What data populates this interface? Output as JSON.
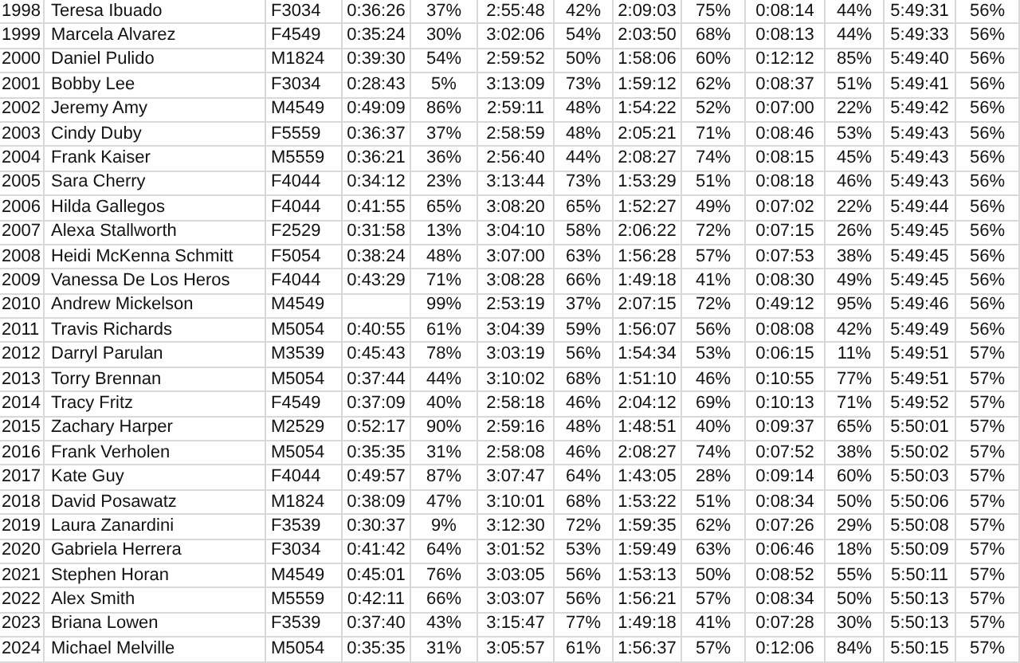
{
  "table": {
    "rows": [
      {
        "cells": [
          "1998",
          "Teresa Ibuado",
          "F3034",
          "0:36:26",
          "37%",
          "2:55:48",
          "42%",
          "2:09:03",
          "75%",
          "0:08:14",
          "44%",
          "5:49:31",
          "56%"
        ]
      },
      {
        "cells": [
          "1999",
          "Marcela Alvarez",
          "F4549",
          "0:35:24",
          "30%",
          "3:02:06",
          "54%",
          "2:03:50",
          "68%",
          "0:08:13",
          "44%",
          "5:49:33",
          "56%"
        ]
      },
      {
        "cells": [
          "2000",
          "Daniel Pulido",
          "M1824",
          "0:39:30",
          "54%",
          "2:59:52",
          "50%",
          "1:58:06",
          "60%",
          "0:12:12",
          "85%",
          "5:49:40",
          "56%"
        ]
      },
      {
        "cells": [
          "2001",
          "Bobby Lee",
          "F3034",
          "0:28:43",
          "5%",
          "3:13:09",
          "73%",
          "1:59:12",
          "62%",
          "0:08:37",
          "51%",
          "5:49:41",
          "56%"
        ]
      },
      {
        "cells": [
          "2002",
          "Jeremy Amy",
          "M4549",
          "0:49:09",
          "86%",
          "2:59:11",
          "48%",
          "1:54:22",
          "52%",
          "0:07:00",
          "22%",
          "5:49:42",
          "56%"
        ]
      },
      {
        "cells": [
          "2003",
          "Cindy Duby",
          "F5559",
          "0:36:37",
          "37%",
          "2:58:59",
          "48%",
          "2:05:21",
          "71%",
          "0:08:46",
          "53%",
          "5:49:43",
          "56%"
        ]
      },
      {
        "cells": [
          "2004",
          "Frank Kaiser",
          "M5559",
          "0:36:21",
          "36%",
          "2:56:40",
          "44%",
          "2:08:27",
          "74%",
          "0:08:15",
          "45%",
          "5:49:43",
          "56%"
        ]
      },
      {
        "cells": [
          "2005",
          "Sara Cherry",
          "F4044",
          "0:34:12",
          "23%",
          "3:13:44",
          "73%",
          "1:53:29",
          "51%",
          "0:08:18",
          "46%",
          "5:49:43",
          "56%"
        ]
      },
      {
        "cells": [
          "2006",
          "Hilda Gallegos",
          "F4044",
          "0:41:55",
          "65%",
          "3:08:20",
          "65%",
          "1:52:27",
          "49%",
          "0:07:02",
          "22%",
          "5:49:44",
          "56%"
        ]
      },
      {
        "cells": [
          "2007",
          "Alexa Stallworth",
          "F2529",
          "0:31:58",
          "13%",
          "3:04:10",
          "58%",
          "2:06:22",
          "72%",
          "0:07:15",
          "26%",
          "5:49:45",
          "56%"
        ]
      },
      {
        "cells": [
          "2008",
          "Heidi McKenna Schmitt",
          "F5054",
          "0:38:24",
          "48%",
          "3:07:00",
          "63%",
          "1:56:28",
          "57%",
          "0:07:53",
          "38%",
          "5:49:45",
          "56%"
        ]
      },
      {
        "cells": [
          "2009",
          "Vanessa De Los Heros",
          "F4044",
          "0:43:29",
          "71%",
          "3:08:28",
          "66%",
          "1:49:18",
          "41%",
          "0:08:30",
          "49%",
          "5:49:45",
          "56%"
        ]
      },
      {
        "cells": [
          "2010",
          "Andrew Mickelson",
          "M4549",
          null,
          "99%",
          "2:53:19",
          "37%",
          "2:07:15",
          "72%",
          "0:49:12",
          "95%",
          "5:49:46",
          "56%"
        ]
      },
      {
        "cells": [
          "2011",
          "Travis Richards",
          "M5054",
          "0:40:55",
          "61%",
          "3:04:39",
          "59%",
          "1:56:07",
          "56%",
          "0:08:08",
          "42%",
          "5:49:49",
          "56%"
        ]
      },
      {
        "cells": [
          "2012",
          "Darryl Parulan",
          "M3539",
          "0:45:43",
          "78%",
          "3:03:19",
          "56%",
          "1:54:34",
          "53%",
          "0:06:15",
          "11%",
          "5:49:51",
          "57%"
        ]
      },
      {
        "cells": [
          "2013",
          "Torry Brennan",
          "M5054",
          "0:37:44",
          "44%",
          "3:10:02",
          "68%",
          "1:51:10",
          "46%",
          "0:10:55",
          "77%",
          "5:49:51",
          "57%"
        ]
      },
      {
        "cells": [
          "2014",
          "Tracy Fritz",
          "F4549",
          "0:37:09",
          "40%",
          "2:58:18",
          "46%",
          "2:04:12",
          "69%",
          "0:10:13",
          "71%",
          "5:49:52",
          "57%"
        ]
      },
      {
        "cells": [
          "2015",
          "Zachary Harper",
          "M2529",
          "0:52:17",
          "90%",
          "2:59:16",
          "48%",
          "1:48:51",
          "40%",
          "0:09:37",
          "65%",
          "5:50:01",
          "57%"
        ]
      },
      {
        "cells": [
          "2016",
          "Frank Verholen",
          "M5054",
          "0:35:35",
          "31%",
          "2:58:08",
          "46%",
          "2:08:27",
          "74%",
          "0:07:52",
          "38%",
          "5:50:02",
          "57%"
        ]
      },
      {
        "cells": [
          "2017",
          "Kate Guy",
          "F4044",
          "0:49:57",
          "87%",
          "3:07:47",
          "64%",
          "1:43:05",
          "28%",
          "0:09:14",
          "60%",
          "5:50:03",
          "57%"
        ]
      },
      {
        "cells": [
          "2018",
          "David Posawatz",
          "M1824",
          "0:38:09",
          "47%",
          "3:10:01",
          "68%",
          "1:53:22",
          "51%",
          "0:08:34",
          "50%",
          "5:50:06",
          "57%"
        ]
      },
      {
        "cells": [
          "2019",
          "Laura Zanardini",
          "F3539",
          "0:30:37",
          "9%",
          "3:12:30",
          "72%",
          "1:59:35",
          "62%",
          "0:07:26",
          "29%",
          "5:50:08",
          "57%"
        ]
      },
      {
        "cells": [
          "2020",
          "Gabriela Herrera",
          "F3034",
          "0:41:42",
          "64%",
          "3:01:52",
          "53%",
          "1:59:49",
          "63%",
          "0:06:46",
          "18%",
          "5:50:09",
          "57%"
        ]
      },
      {
        "cells": [
          "2021",
          "Stephen Horan",
          "M4549",
          "0:45:01",
          "76%",
          "3:03:05",
          "56%",
          "1:53:13",
          "50%",
          "0:08:52",
          "55%",
          "5:50:11",
          "57%"
        ]
      },
      {
        "cells": [
          "2022",
          "Alex Smith",
          "M5559",
          "0:42:11",
          "66%",
          "3:03:07",
          "56%",
          "1:56:21",
          "57%",
          "0:08:34",
          "50%",
          "5:50:13",
          "57%"
        ]
      },
      {
        "cells": [
          "2023",
          "Briana Lowen",
          "F3539",
          "0:37:40",
          "43%",
          "3:15:47",
          "77%",
          "1:49:18",
          "41%",
          "0:07:28",
          "30%",
          "5:50:13",
          "57%"
        ]
      },
      {
        "cells": [
          "2024",
          "Michael Melville",
          "M5054",
          "0:35:35",
          "31%",
          "3:05:57",
          "61%",
          "1:56:37",
          "57%",
          "0:12:06",
          "84%",
          "5:50:15",
          "57%"
        ]
      }
    ]
  }
}
